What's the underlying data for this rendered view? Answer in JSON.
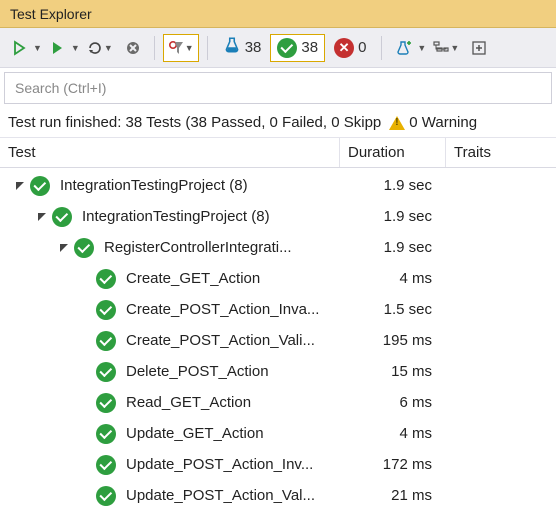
{
  "title": "Test Explorer",
  "search": {
    "placeholder": "Search (Ctrl+I)"
  },
  "status": {
    "text": "Test run finished: 38 Tests (38 Passed, 0 Failed, 0 Skipp",
    "warning": "0 Warning"
  },
  "counters": {
    "total": "38",
    "passed": "38",
    "failed": "0"
  },
  "columns": {
    "test": "Test",
    "duration": "Duration",
    "traits": "Traits"
  },
  "tree": [
    {
      "level": 0,
      "expandable": true,
      "expanded": true,
      "name": "IntegrationTestingProject  (8)",
      "duration": "1.9 sec"
    },
    {
      "level": 1,
      "expandable": true,
      "expanded": true,
      "name": "IntegrationTestingProject  (8)",
      "duration": "1.9 sec"
    },
    {
      "level": 2,
      "expandable": true,
      "expanded": true,
      "name": "RegisterControllerIntegrati...",
      "duration": "1.9 sec"
    },
    {
      "level": 3,
      "expandable": false,
      "name": "Create_GET_Action",
      "duration": "4 ms"
    },
    {
      "level": 3,
      "expandable": false,
      "name": "Create_POST_Action_Inva...",
      "duration": "1.5 sec"
    },
    {
      "level": 3,
      "expandable": false,
      "name": "Create_POST_Action_Vali...",
      "duration": "195 ms"
    },
    {
      "level": 3,
      "expandable": false,
      "name": "Delete_POST_Action",
      "duration": "15 ms"
    },
    {
      "level": 3,
      "expandable": false,
      "name": "Read_GET_Action",
      "duration": "6 ms"
    },
    {
      "level": 3,
      "expandable": false,
      "name": "Update_GET_Action",
      "duration": "4 ms"
    },
    {
      "level": 3,
      "expandable": false,
      "name": "Update_POST_Action_Inv...",
      "duration": "172 ms"
    },
    {
      "level": 3,
      "expandable": false,
      "name": "Update_POST_Action_Val...",
      "duration": "21 ms"
    }
  ]
}
